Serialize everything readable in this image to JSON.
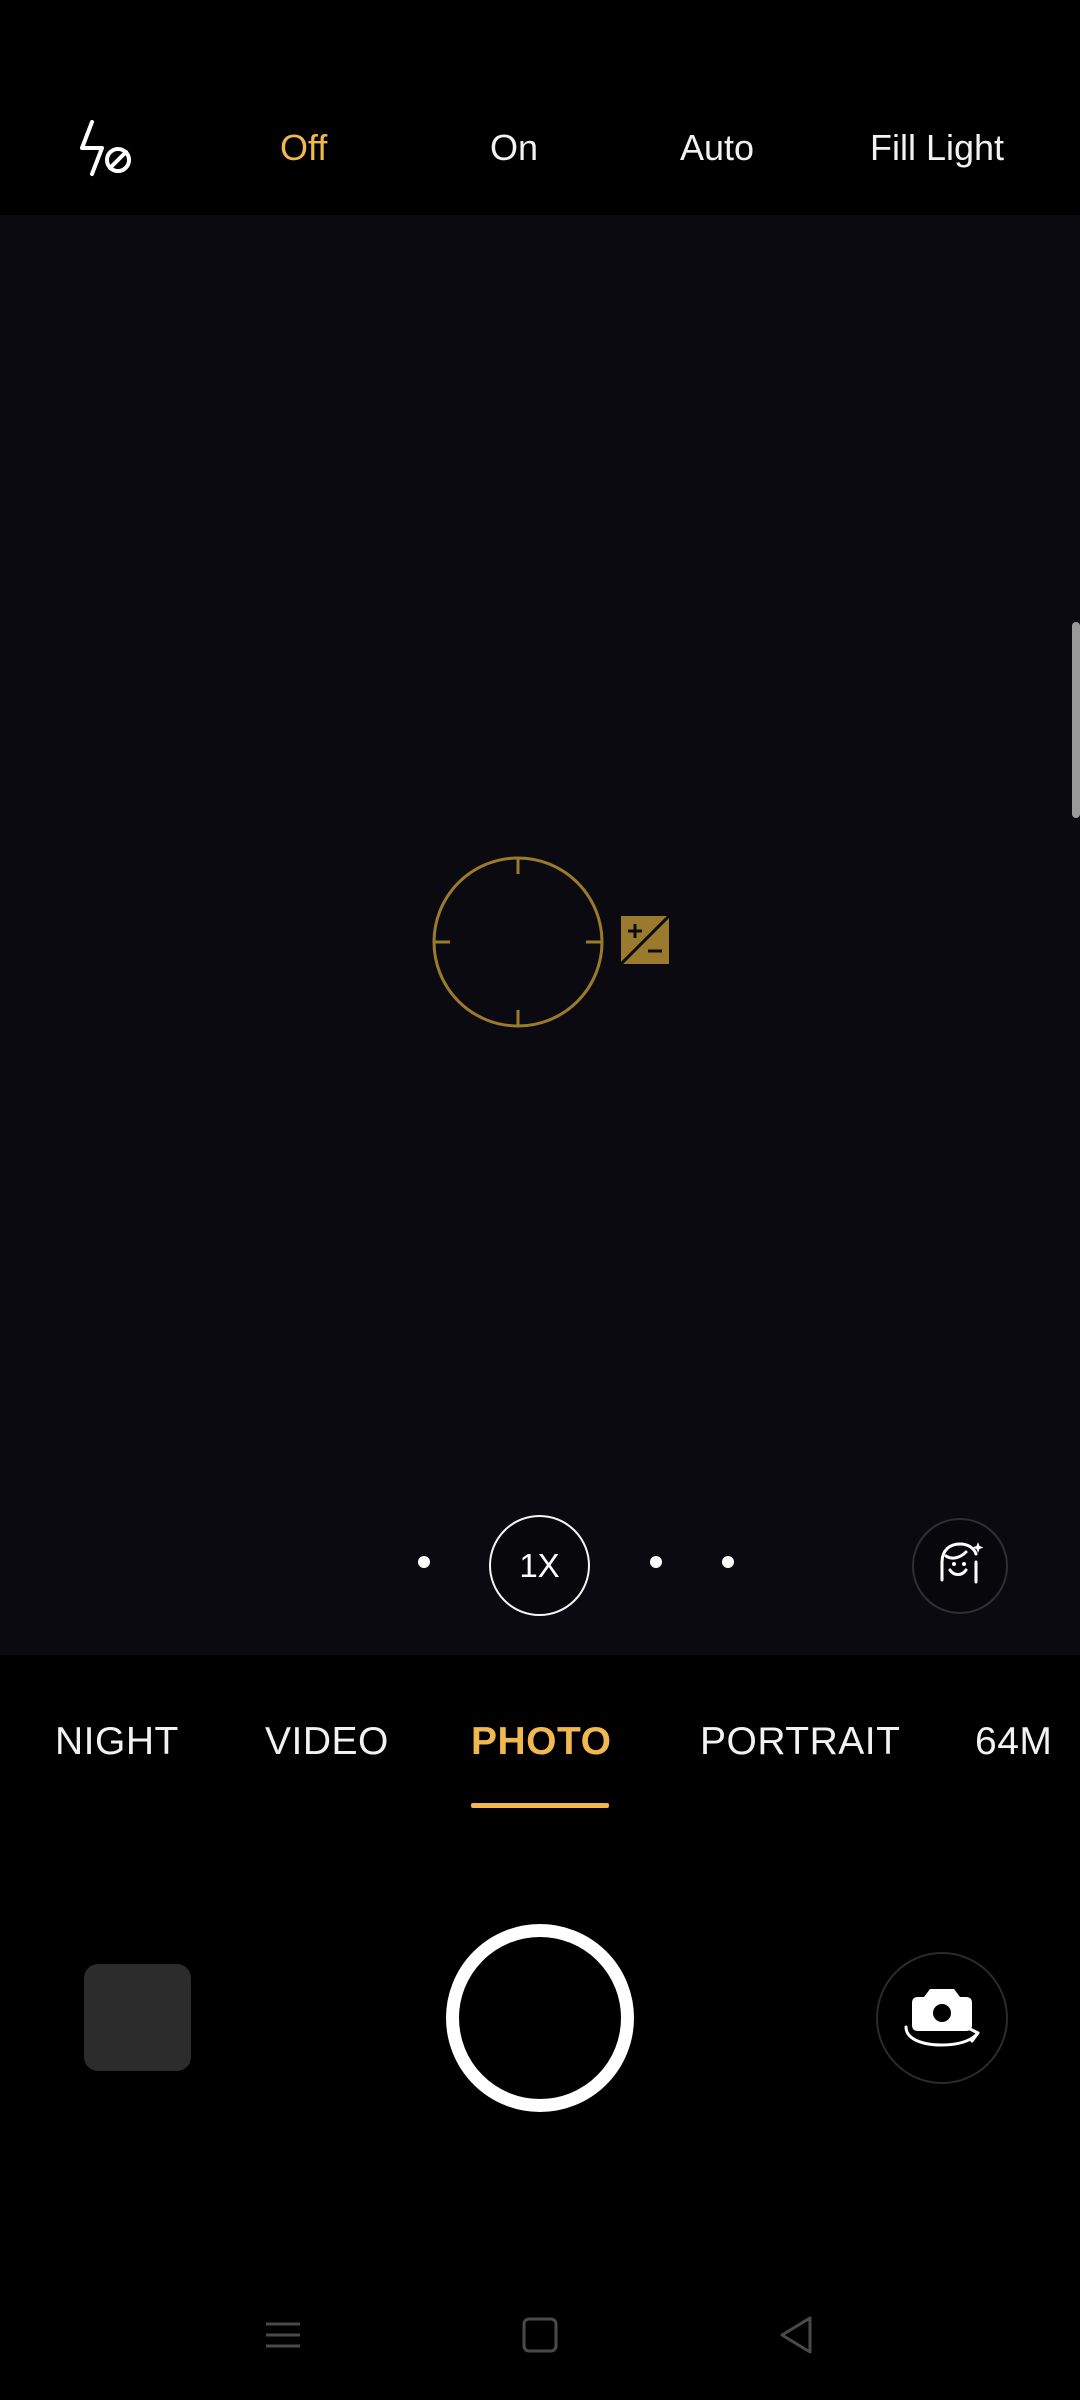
{
  "flash": {
    "icon": "flash-off-icon",
    "options": [
      {
        "label": "Off",
        "active": true
      },
      {
        "label": "On",
        "active": false
      },
      {
        "label": "Auto",
        "active": false
      },
      {
        "label": "Fill Light",
        "active": false
      }
    ]
  },
  "viewfinder": {
    "focus_icon": "focus-ring-icon",
    "exposure_icon": "exposure-compensation-icon",
    "zoom_label": "1X",
    "beauty_icon": "beauty-face-icon"
  },
  "modes": {
    "items": [
      "NIGHT",
      "VIDEO",
      "PHOTO",
      "PORTRAIT",
      "64M"
    ],
    "active": "PHOTO"
  },
  "controls": {
    "gallery_icon": "gallery-thumbnail",
    "shutter_icon": "shutter-button",
    "switch_icon": "switch-camera-icon"
  },
  "nav": {
    "items": [
      "menu-icon",
      "home-icon",
      "back-icon"
    ]
  },
  "colors": {
    "accent": "#f0b84e",
    "viewfinder_bg": "#0b0a10",
    "focus": "#b08a2e"
  }
}
